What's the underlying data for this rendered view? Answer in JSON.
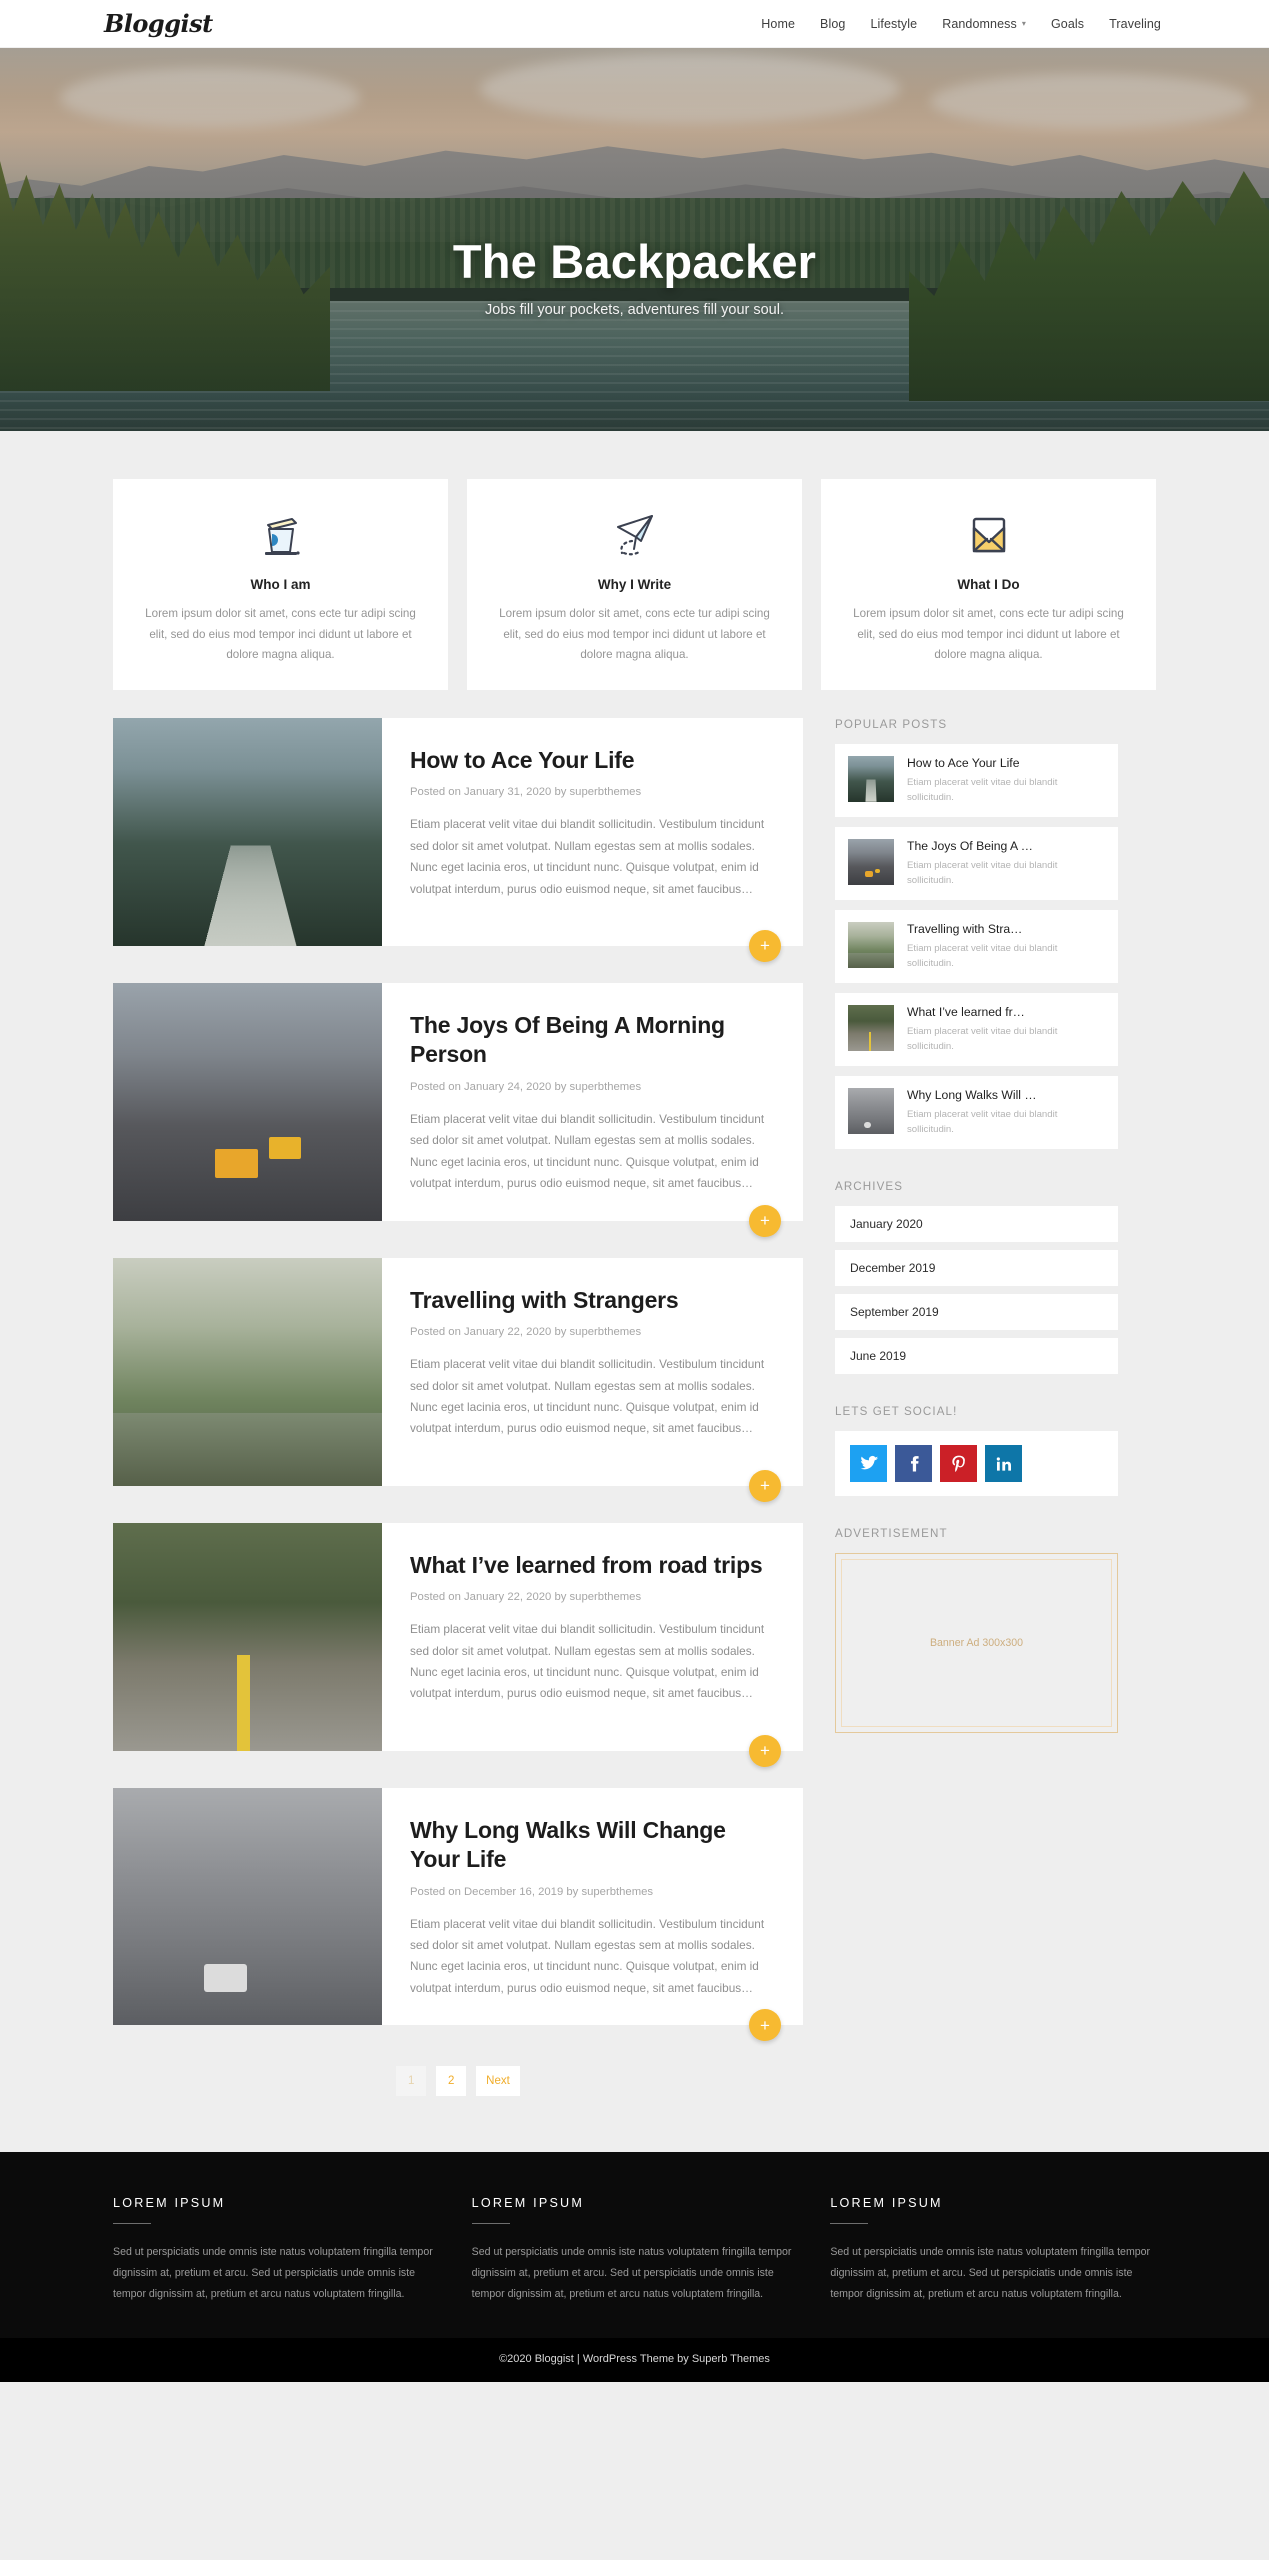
{
  "header": {
    "brand": "Bloggist",
    "nav": [
      {
        "label": "Home",
        "has_caret": false
      },
      {
        "label": "Blog",
        "has_caret": false
      },
      {
        "label": "Lifestyle",
        "has_caret": false
      },
      {
        "label": "Randomness",
        "has_caret": true
      },
      {
        "label": "Goals",
        "has_caret": false
      },
      {
        "label": "Traveling",
        "has_caret": false
      }
    ]
  },
  "hero": {
    "title": "The Backpacker",
    "subtitle": "Jobs fill your pockets, adventures fill your soul."
  },
  "features": [
    {
      "icon": "coffee-cup-icon",
      "title": "Who I am",
      "text": "Lorem ipsum dolor sit amet, cons ecte tur adipi scing elit, sed do eius mod tempor inci didunt ut labore et dolore magna aliqua."
    },
    {
      "icon": "paper-plane-icon",
      "title": "Why I Write",
      "text": "Lorem ipsum dolor sit amet, cons ecte tur adipi scing elit, sed do eius mod tempor inci didunt ut labore et dolore magna aliqua."
    },
    {
      "icon": "envelope-icon",
      "title": "What I Do",
      "text": "Lorem ipsum dolor sit amet, cons ecte tur adipi scing elit, sed do eius mod tempor inci didunt ut labore et dolore magna aliqua."
    }
  ],
  "posts": [
    {
      "title": "How to Ace Your Life",
      "meta": "Posted on January 31, 2020 by superbthemes",
      "excerpt": "Etiam placerat velit vitae dui blandit sollicitudin. Vestibulum tincidunt sed dolor sit amet volutpat. Nullam egestas sem at mollis sodales. Nunc eget lacinia eros, ut tincidunt nunc. Quisque volutpat, enim id volutpat interdum, purus odio euismod neque, sit amet faucibus…",
      "read_more": "+"
    },
    {
      "title": "The Joys Of Being A Morning Person",
      "meta": "Posted on January 24, 2020 by superbthemes",
      "excerpt": "Etiam placerat velit vitae dui blandit sollicitudin. Vestibulum tincidunt sed dolor sit amet volutpat. Nullam egestas sem at mollis sodales. Nunc eget lacinia eros, ut tincidunt nunc. Quisque volutpat, enim id volutpat interdum, purus odio euismod neque, sit amet faucibus…",
      "read_more": "+"
    },
    {
      "title": "Travelling with Strangers",
      "meta": "Posted on January 22, 2020 by superbthemes",
      "excerpt": "Etiam placerat velit vitae dui blandit sollicitudin. Vestibulum tincidunt sed dolor sit amet volutpat. Nullam egestas sem at mollis sodales. Nunc eget lacinia eros, ut tincidunt nunc. Quisque volutpat, enim id volutpat interdum, purus odio euismod neque, sit amet faucibus…",
      "read_more": "+"
    },
    {
      "title": "What I’ve learned from road trips",
      "meta": "Posted on January 22, 2020 by superbthemes",
      "excerpt": "Etiam placerat velit vitae dui blandit sollicitudin. Vestibulum tincidunt sed dolor sit amet volutpat. Nullam egestas sem at mollis sodales. Nunc eget lacinia eros, ut tincidunt nunc. Quisque volutpat, enim id volutpat interdum, purus odio euismod neque, sit amet faucibus…",
      "read_more": "+"
    },
    {
      "title": "Why Long Walks Will Change Your Life",
      "meta": "Posted on December 16, 2019 by superbthemes",
      "excerpt": "Etiam placerat velit vitae dui blandit sollicitudin. Vestibulum tincidunt sed dolor sit amet volutpat. Nullam egestas sem at mollis sodales. Nunc eget lacinia eros, ut tincidunt nunc. Quisque volutpat, enim id volutpat interdum, purus odio euismod neque, sit amet faucibus…",
      "read_more": "+"
    }
  ],
  "pagination": [
    {
      "label": "1",
      "current": true
    },
    {
      "label": "2",
      "current": false
    },
    {
      "label": "Next",
      "current": false
    }
  ],
  "sidebar": {
    "popular_posts": {
      "title": "POPULAR POSTS",
      "items": [
        {
          "title": "How to Ace Your Life",
          "excerpt": "Etiam placerat velit vitae dui blandit sollicitudin."
        },
        {
          "title": "The Joys Of Being A …",
          "excerpt": "Etiam placerat velit vitae dui blandit sollicitudin."
        },
        {
          "title": "Travelling with Stra…",
          "excerpt": "Etiam placerat velit vitae dui blandit sollicitudin."
        },
        {
          "title": "What I’ve learned fr…",
          "excerpt": "Etiam placerat velit vitae dui blandit sollicitudin."
        },
        {
          "title": "Why Long Walks Will …",
          "excerpt": "Etiam placerat velit vitae dui blandit sollicitudin."
        }
      ]
    },
    "archives": {
      "title": "ARCHIVES",
      "items": [
        "January 2020",
        "December 2019",
        "September 2019",
        "June 2019"
      ]
    },
    "social": {
      "title": "LETS GET SOCIAL!",
      "items": [
        {
          "name": "twitter-icon",
          "glyph": "🐦",
          "color": "#1da1f2"
        },
        {
          "name": "facebook-icon",
          "glyph": "f",
          "color": "#3b5998"
        },
        {
          "name": "pinterest-icon",
          "glyph": "P",
          "color": "#cb2027"
        },
        {
          "name": "linkedin-icon",
          "glyph": "in",
          "color": "#0e76a8"
        }
      ]
    },
    "advertisement": {
      "title": "ADVERTISEMENT",
      "banner_text": "Banner Ad 300x300"
    }
  },
  "footer": {
    "columns": [
      {
        "title": "LOREM IPSUM",
        "text": "Sed ut perspiciatis unde omnis iste natus voluptatem fringilla tempor dignissim at, pretium et arcu. Sed ut perspiciatis unde omnis iste tempor dignissim at, pretium et arcu natus voluptatem fringilla."
      },
      {
        "title": "LOREM IPSUM",
        "text": "Sed ut perspiciatis unde omnis iste natus voluptatem fringilla tempor dignissim at, pretium et arcu. Sed ut perspiciatis unde omnis iste tempor dignissim at, pretium et arcu natus voluptatem fringilla."
      },
      {
        "title": "LOREM IPSUM",
        "text": "Sed ut perspiciatis unde omnis iste natus voluptatem fringilla tempor dignissim at, pretium et arcu. Sed ut perspiciatis unde omnis iste tempor dignissim at, pretium et arcu natus voluptatem fringilla."
      }
    ],
    "copyright": "©2020 Bloggist | WordPress Theme by Superb Themes"
  },
  "colors": {
    "accent": "#f7ba31",
    "footer_bg": "#0b0b0b",
    "page_bg": "#eeeeee"
  }
}
